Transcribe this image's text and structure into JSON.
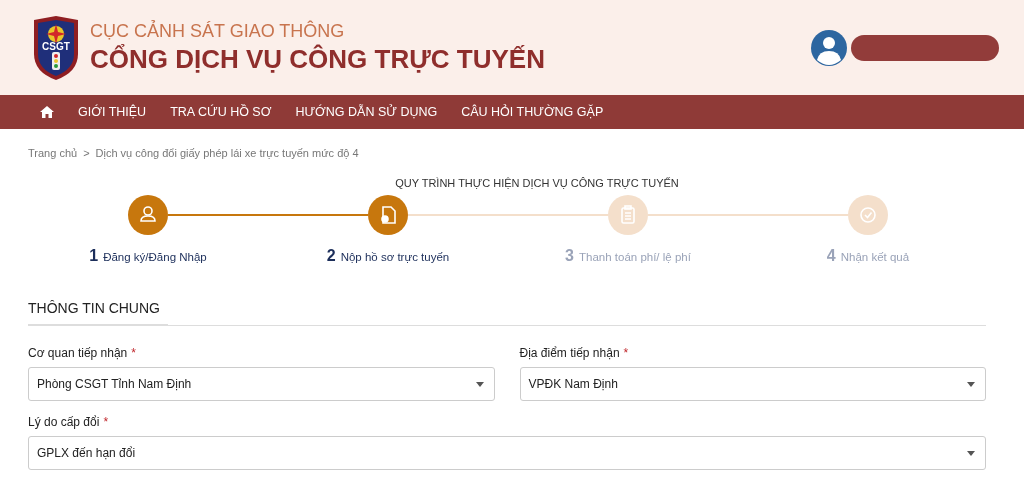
{
  "header": {
    "agency": "CỤC CẢNH SÁT GIAO THÔNG",
    "portal": "CỔNG DỊCH VỤ CÔNG TRỰC TUYẾN",
    "logo_text": "CSGT"
  },
  "nav": {
    "items": [
      "GIỚI THIỆU",
      "TRA CỨU HỒ SƠ",
      "HƯỚNG DẪN SỬ DỤNG",
      "CÂU HỎI THƯỜNG GẶP"
    ]
  },
  "breadcrumb": {
    "items": [
      "Trang chủ",
      "Dịch vụ công đổi giấy phép lái xe trực tuyến mức độ 4"
    ],
    "separator": ">"
  },
  "process": {
    "title": "QUY TRÌNH THỰC HIỆN DỊCH VỤ CÔNG TRỰC TUYẾN",
    "steps": [
      {
        "number": "1",
        "label": "Đăng ký/Đăng Nhập",
        "done": true,
        "kind": "user"
      },
      {
        "number": "2",
        "label": "Nộp hồ sơ trực tuyến",
        "done": true,
        "kind": "document"
      },
      {
        "number": "3",
        "label": "Thanh toán phí/ lệ phí",
        "done": false,
        "kind": "clipboard"
      },
      {
        "number": "4",
        "label": "Nhận kết quả",
        "done": false,
        "kind": "check"
      }
    ]
  },
  "section": {
    "title": "THÔNG TIN CHUNG",
    "fields": [
      {
        "label": "Cơ quan tiếp nhận",
        "required": true,
        "value": "Phòng CSGT Tỉnh Nam Định",
        "wide": false
      },
      {
        "label": "Địa điểm tiếp nhận",
        "required": true,
        "value": "VPĐK Nam Định",
        "wide": false
      },
      {
        "label": "Lý do cấp đổi",
        "required": true,
        "value": "GPLX đến hạn đổi",
        "wide": true
      }
    ],
    "required_mark": "*"
  }
}
